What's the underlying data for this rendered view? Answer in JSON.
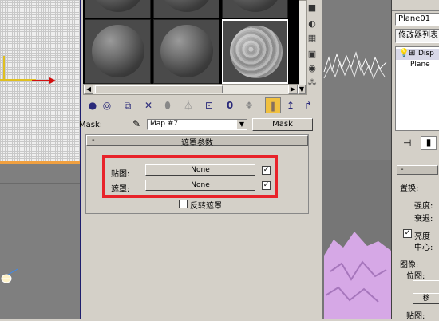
{
  "material_editor": {
    "mask_label": "Mask:",
    "map_name": "Map #7",
    "mask_button": "Mask",
    "rollout_title": "遮罩参数",
    "rollout_toggle": "-",
    "map_label": "贴图:",
    "map_value": "None",
    "mask_field_label": "遮罩:",
    "mask_value": "None",
    "invert_label": "反转遮罩"
  },
  "command_panel": {
    "object_name": "Plane01",
    "modifier_list": "修改器列表",
    "stack_item_1": "Disp",
    "stack_item_2": "Plane",
    "section_toggle": "-",
    "displace_title": "置换:",
    "strength_label": "强度:",
    "decay_label": "衰退:",
    "luminance_label": "亮度",
    "center_label": "中心:",
    "image_title": "图像:",
    "bitmap_label": "位图:",
    "remove_label": "移",
    "map_label": "贴图:"
  },
  "colors": {
    "highlight": "#e8232a",
    "accent_orange": "#f0a040",
    "mesh_pink": "#d6a8e6"
  }
}
